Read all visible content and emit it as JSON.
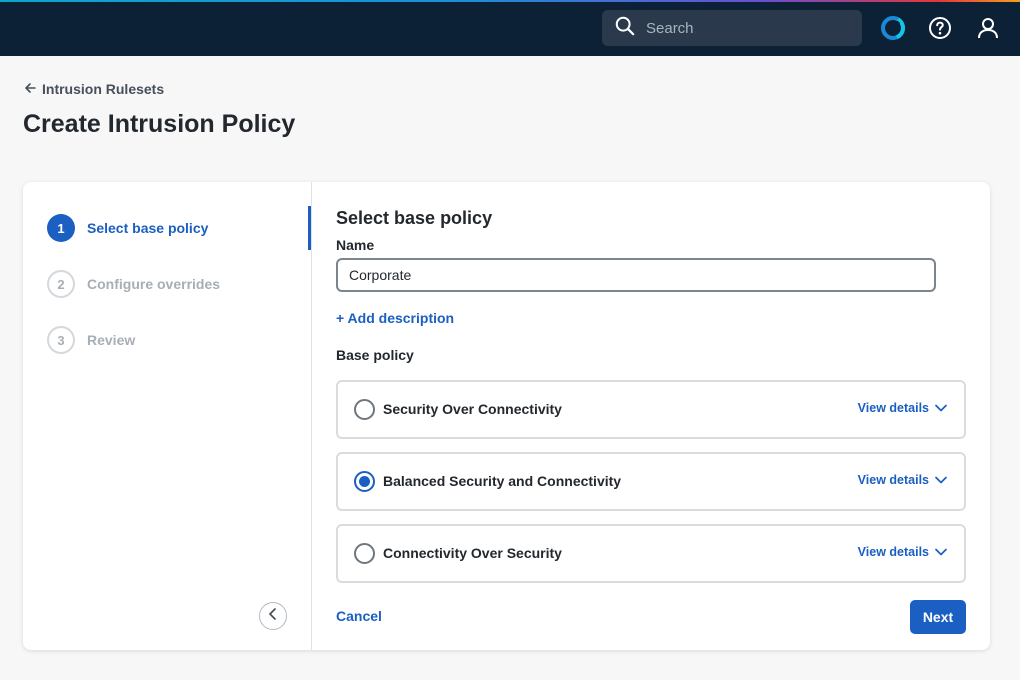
{
  "header": {
    "search_placeholder": "Search",
    "icons": [
      "search-icon",
      "app-logo-icon",
      "help-icon",
      "user-icon"
    ]
  },
  "breadcrumb": {
    "back_label": "Intrusion Rulesets"
  },
  "page": {
    "title": "Create Intrusion Policy"
  },
  "steps": [
    {
      "number": "1",
      "label": "Select base policy",
      "state": "active"
    },
    {
      "number": "2",
      "label": "Configure overrides",
      "state": "inactive"
    },
    {
      "number": "3",
      "label": "Review",
      "state": "inactive"
    }
  ],
  "form": {
    "section_title": "Select base policy",
    "name_label": "Name",
    "name_value": "Corporate",
    "add_description": "+ Add description",
    "base_policy_label": "Base policy",
    "options": [
      {
        "label": "Security Over Connectivity",
        "selected": false,
        "details": "View details"
      },
      {
        "label": "Balanced Security and Connectivity",
        "selected": true,
        "details": "View details"
      },
      {
        "label": "Connectivity Over Security",
        "selected": false,
        "details": "View details"
      }
    ],
    "cancel_label": "Cancel",
    "next_label": "Next"
  },
  "colors": {
    "topbar": "#0d2136",
    "accent": "#1b5fc2",
    "text": "#23282e"
  }
}
